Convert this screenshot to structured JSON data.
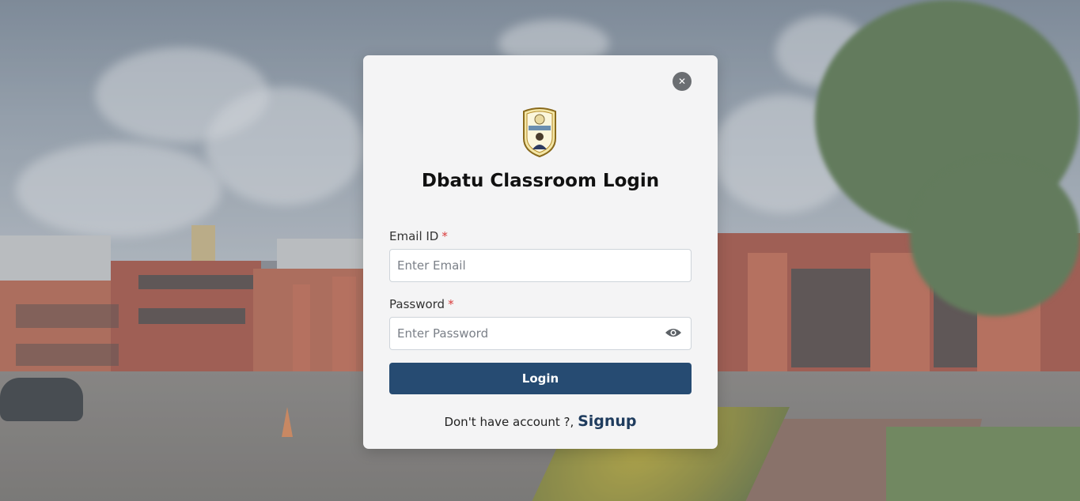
{
  "login": {
    "title": "Dbatu Classroom Login",
    "email_label": "Email ID",
    "email_placeholder": "Enter Email",
    "password_label": "Password",
    "password_placeholder": "Enter Password",
    "required_mark": "*",
    "login_button": "Login",
    "signup_prompt": "Don't have account ?,",
    "signup_link": "Signup"
  },
  "icons": {
    "close": "close-icon",
    "eye": "eye-icon",
    "logo": "university-logo"
  },
  "colors": {
    "primary_button": "#264b72",
    "signup_link": "#1f3c5e",
    "required": "#d93a3a",
    "close_button": "#6b6e72"
  }
}
